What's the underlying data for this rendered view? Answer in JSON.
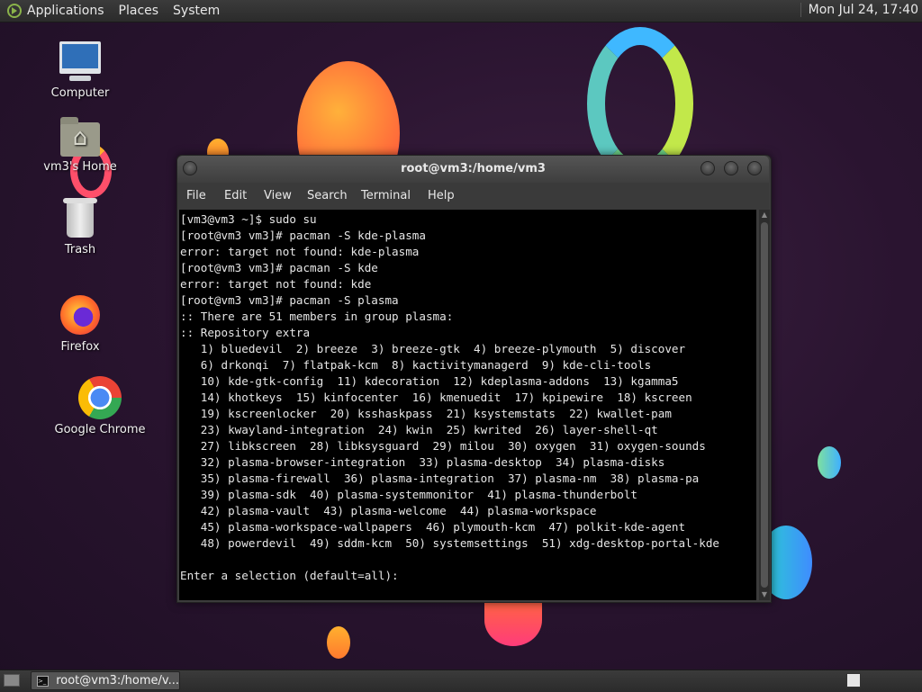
{
  "top_panel": {
    "menus": [
      "Applications",
      "Places",
      "System"
    ],
    "clock": "Mon Jul 24, 17:40"
  },
  "desktop": {
    "icons": [
      {
        "label": "Computer",
        "icon": "computer-icon"
      },
      {
        "label": "vm3's Home",
        "icon": "home-folder-icon"
      },
      {
        "label": "Trash",
        "icon": "trash-icon"
      },
      {
        "label": "Firefox",
        "icon": "firefox-icon"
      },
      {
        "label": "Google Chrome",
        "icon": "chrome-icon"
      }
    ]
  },
  "window": {
    "title": "root@vm3:/home/vm3",
    "menu": [
      "File",
      "Edit",
      "View",
      "Search",
      "Terminal",
      "Help"
    ],
    "terminal_lines": [
      "[vm3@vm3 ~]$ sudo su",
      "[root@vm3 vm3]# pacman -S kde-plasma",
      "error: target not found: kde-plasma",
      "[root@vm3 vm3]# pacman -S kde",
      "error: target not found: kde",
      "[root@vm3 vm3]# pacman -S plasma",
      ":: There are 51 members in group plasma:",
      ":: Repository extra",
      "   1) bluedevil  2) breeze  3) breeze-gtk  4) breeze-plymouth  5) discover",
      "   6) drkonqi  7) flatpak-kcm  8) kactivitymanagerd  9) kde-cli-tools",
      "   10) kde-gtk-config  11) kdecoration  12) kdeplasma-addons  13) kgamma5",
      "   14) khotkeys  15) kinfocenter  16) kmenuedit  17) kpipewire  18) kscreen",
      "   19) kscreenlocker  20) ksshaskpass  21) ksystemstats  22) kwallet-pam",
      "   23) kwayland-integration  24) kwin  25) kwrited  26) layer-shell-qt",
      "   27) libkscreen  28) libksysguard  29) milou  30) oxygen  31) oxygen-sounds",
      "   32) plasma-browser-integration  33) plasma-desktop  34) plasma-disks",
      "   35) plasma-firewall  36) plasma-integration  37) plasma-nm  38) plasma-pa",
      "   39) plasma-sdk  40) plasma-systemmonitor  41) plasma-thunderbolt",
      "   42) plasma-vault  43) plasma-welcome  44) plasma-workspace",
      "   45) plasma-workspace-wallpapers  46) plymouth-kcm  47) polkit-kde-agent",
      "   48) powerdevil  49) sddm-kcm  50) systemsettings  51) xdg-desktop-portal-kde",
      "",
      "Enter a selection (default=all): "
    ]
  },
  "bottom_panel": {
    "task_label": "root@vm3:/home/v..."
  }
}
